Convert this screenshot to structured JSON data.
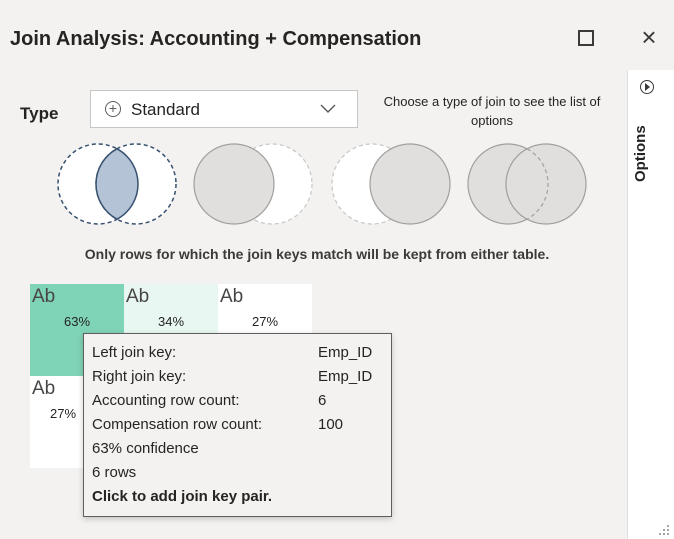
{
  "window": {
    "title": "Join Analysis: Accounting + Compensation"
  },
  "join_type": {
    "label": "Type",
    "selected": "Standard",
    "hint": "Choose a type of join to see the list of options"
  },
  "join_options": [
    {
      "name": "inner"
    },
    {
      "name": "left-outer"
    },
    {
      "name": "right-outer"
    },
    {
      "name": "full-outer"
    }
  ],
  "description": "Only rows for which the join keys match will be kept from either table.",
  "key_grid": {
    "cells": [
      {
        "label": "Ab",
        "percent": "63%",
        "color": "#7fd3b7"
      },
      {
        "label": "Ab",
        "percent": "34%",
        "color": "#e8f7f1"
      },
      {
        "label": "Ab",
        "percent": "27%",
        "color": "#ffffff"
      },
      {
        "label": "Ab",
        "percent": "27%",
        "color": "#ffffff"
      }
    ]
  },
  "tooltip": {
    "rows": [
      {
        "label": "Left join key:",
        "value": "Emp_ID"
      },
      {
        "label": "Right join key:",
        "value": "Emp_ID"
      },
      {
        "label": "Accounting row count:",
        "value": "6"
      },
      {
        "label": "Compensation row count:",
        "value": "100"
      }
    ],
    "confidence": "63% confidence",
    "rows_count": "6 rows",
    "action": "Click to add join key pair."
  },
  "sidebar": {
    "label": "Options"
  },
  "colors": {
    "accent": "#7fd3b7",
    "venn_selected": "#b4c4d6",
    "venn_inactive": "#e1dfdd"
  },
  "icons": [
    "maximize-icon",
    "close-icon",
    "add-circle-icon",
    "chevron-down-icon",
    "play-circle-icon",
    "resize-grip-icon"
  ]
}
